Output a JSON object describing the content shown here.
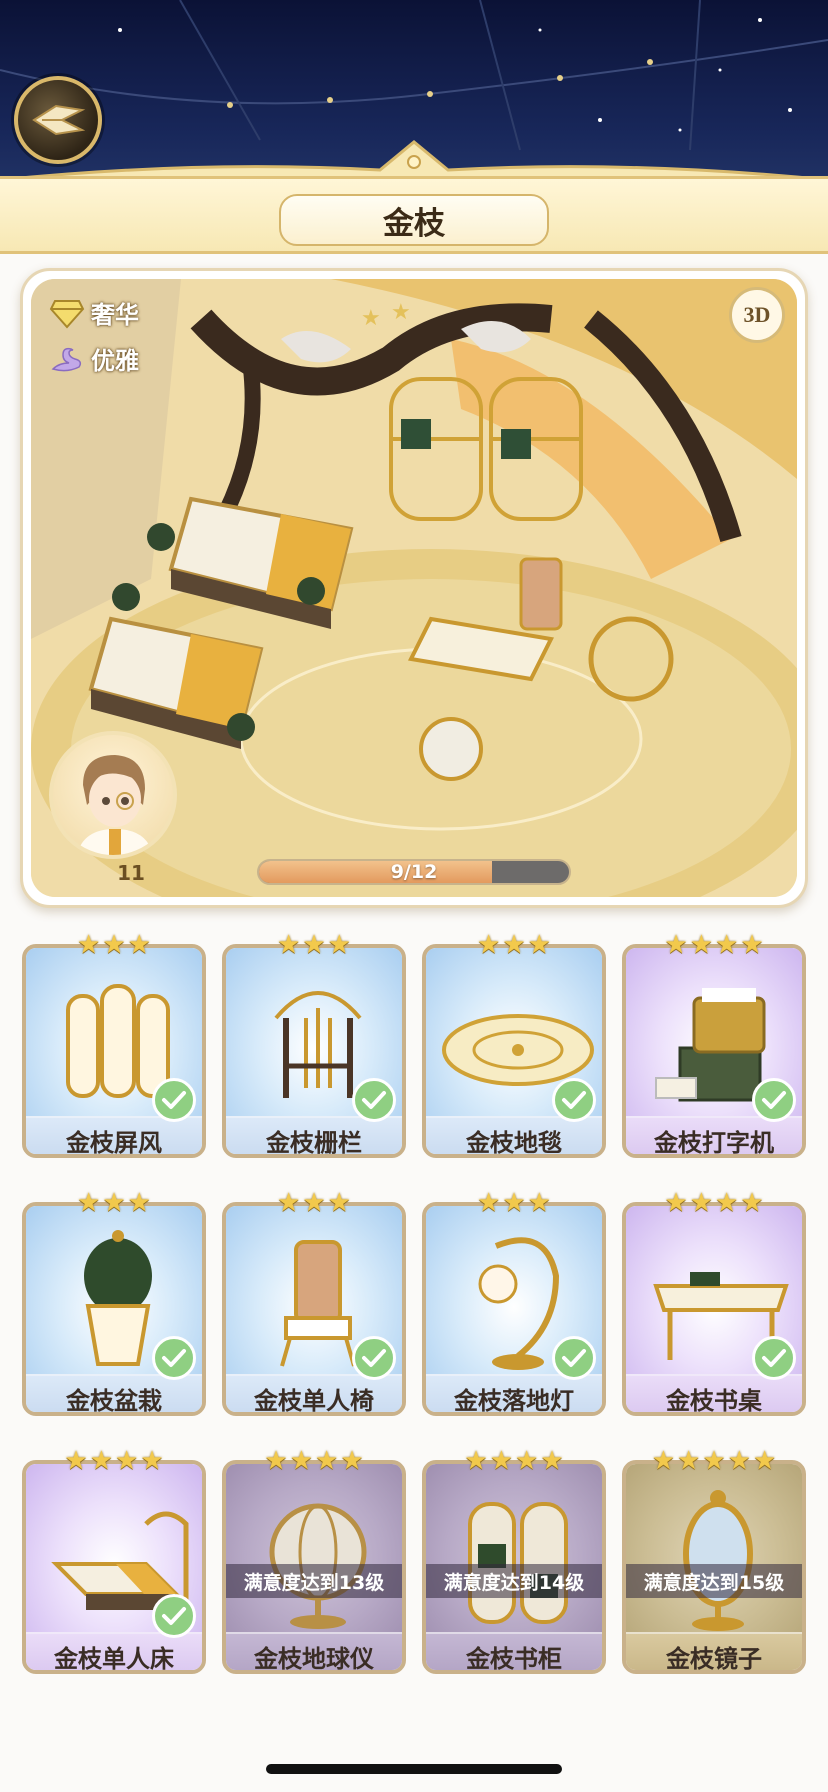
{
  "header": {
    "title": "金枝"
  },
  "room": {
    "tags": [
      {
        "label": "奢华",
        "icon": "diamond-icon"
      },
      {
        "label": "优雅",
        "icon": "swan-icon"
      }
    ],
    "view_3d_label": "3D",
    "character_level": "11",
    "progress_text": "9/12",
    "progress_value": 0.75
  },
  "items": [
    {
      "name": "金枝屏风",
      "stars": 3,
      "theme": "blue",
      "owned": true,
      "art": "screen"
    },
    {
      "name": "金枝栅栏",
      "stars": 3,
      "theme": "blue",
      "owned": true,
      "art": "fence"
    },
    {
      "name": "金枝地毯",
      "stars": 3,
      "theme": "blue",
      "owned": true,
      "art": "rug"
    },
    {
      "name": "金枝打字机",
      "stars": 4,
      "theme": "purple",
      "owned": true,
      "art": "typewriter"
    },
    {
      "name": "金枝盆栽",
      "stars": 3,
      "theme": "blue",
      "owned": true,
      "art": "plant"
    },
    {
      "name": "金枝单人椅",
      "stars": 3,
      "theme": "blue",
      "owned": true,
      "art": "chair"
    },
    {
      "name": "金枝落地灯",
      "stars": 3,
      "theme": "blue",
      "owned": true,
      "art": "lamp"
    },
    {
      "name": "金枝书桌",
      "stars": 4,
      "theme": "purple",
      "owned": true,
      "art": "desk"
    },
    {
      "name": "金枝单人床",
      "stars": 4,
      "theme": "purple",
      "owned": true,
      "art": "bed"
    },
    {
      "name": "金枝地球仪",
      "stars": 4,
      "theme": "locked-p",
      "owned": false,
      "lock_text": "满意度达到13级",
      "art": "globe"
    },
    {
      "name": "金枝书柜",
      "stars": 4,
      "theme": "locked-p",
      "owned": false,
      "lock_text": "满意度达到14级",
      "art": "bookcase"
    },
    {
      "name": "金枝镜子",
      "stars": 5,
      "theme": "locked-g",
      "owned": false,
      "lock_text": "满意度达到15级",
      "art": "mirror"
    }
  ],
  "colors": {
    "gold": "#d9b86a",
    "check_green": "#8fcf82",
    "star_yellow": "#f2c94c",
    "progress_fill": "#e39a5e"
  }
}
